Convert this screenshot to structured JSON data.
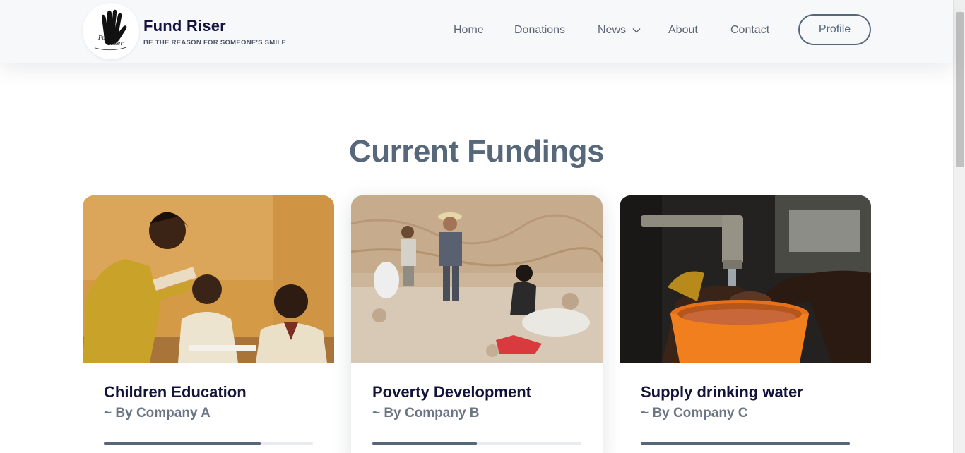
{
  "header": {
    "logo_icon": "hand-logo-icon",
    "logo_text_1": "Fund",
    "logo_text_2": "Riser",
    "brand_name": "Fund Riser",
    "tagline": "BE THE REASON FOR SOMEONE'S SMILE",
    "nav": {
      "home": "Home",
      "donations": "Donations",
      "news": "News",
      "about": "About",
      "contact": "Contact"
    },
    "profile_label": "Profile"
  },
  "main": {
    "section_title": "Current Fundings",
    "cards": [
      {
        "image_icon": "children-classroom-photo",
        "title": "Children Education",
        "company": "~ By Company A",
        "progress": 0.75
      },
      {
        "image_icon": "children-quarry-photo",
        "title": "Poverty Development",
        "company": "~ By Company B",
        "progress": 0.5
      },
      {
        "image_icon": "water-tap-photo",
        "title": "Supply drinking water",
        "company": "~ By Company C",
        "progress": 1.0
      }
    ]
  },
  "colors": {
    "accent": "#56677a",
    "title_dark": "#12123a",
    "header_bg": "#f7f8fa"
  }
}
